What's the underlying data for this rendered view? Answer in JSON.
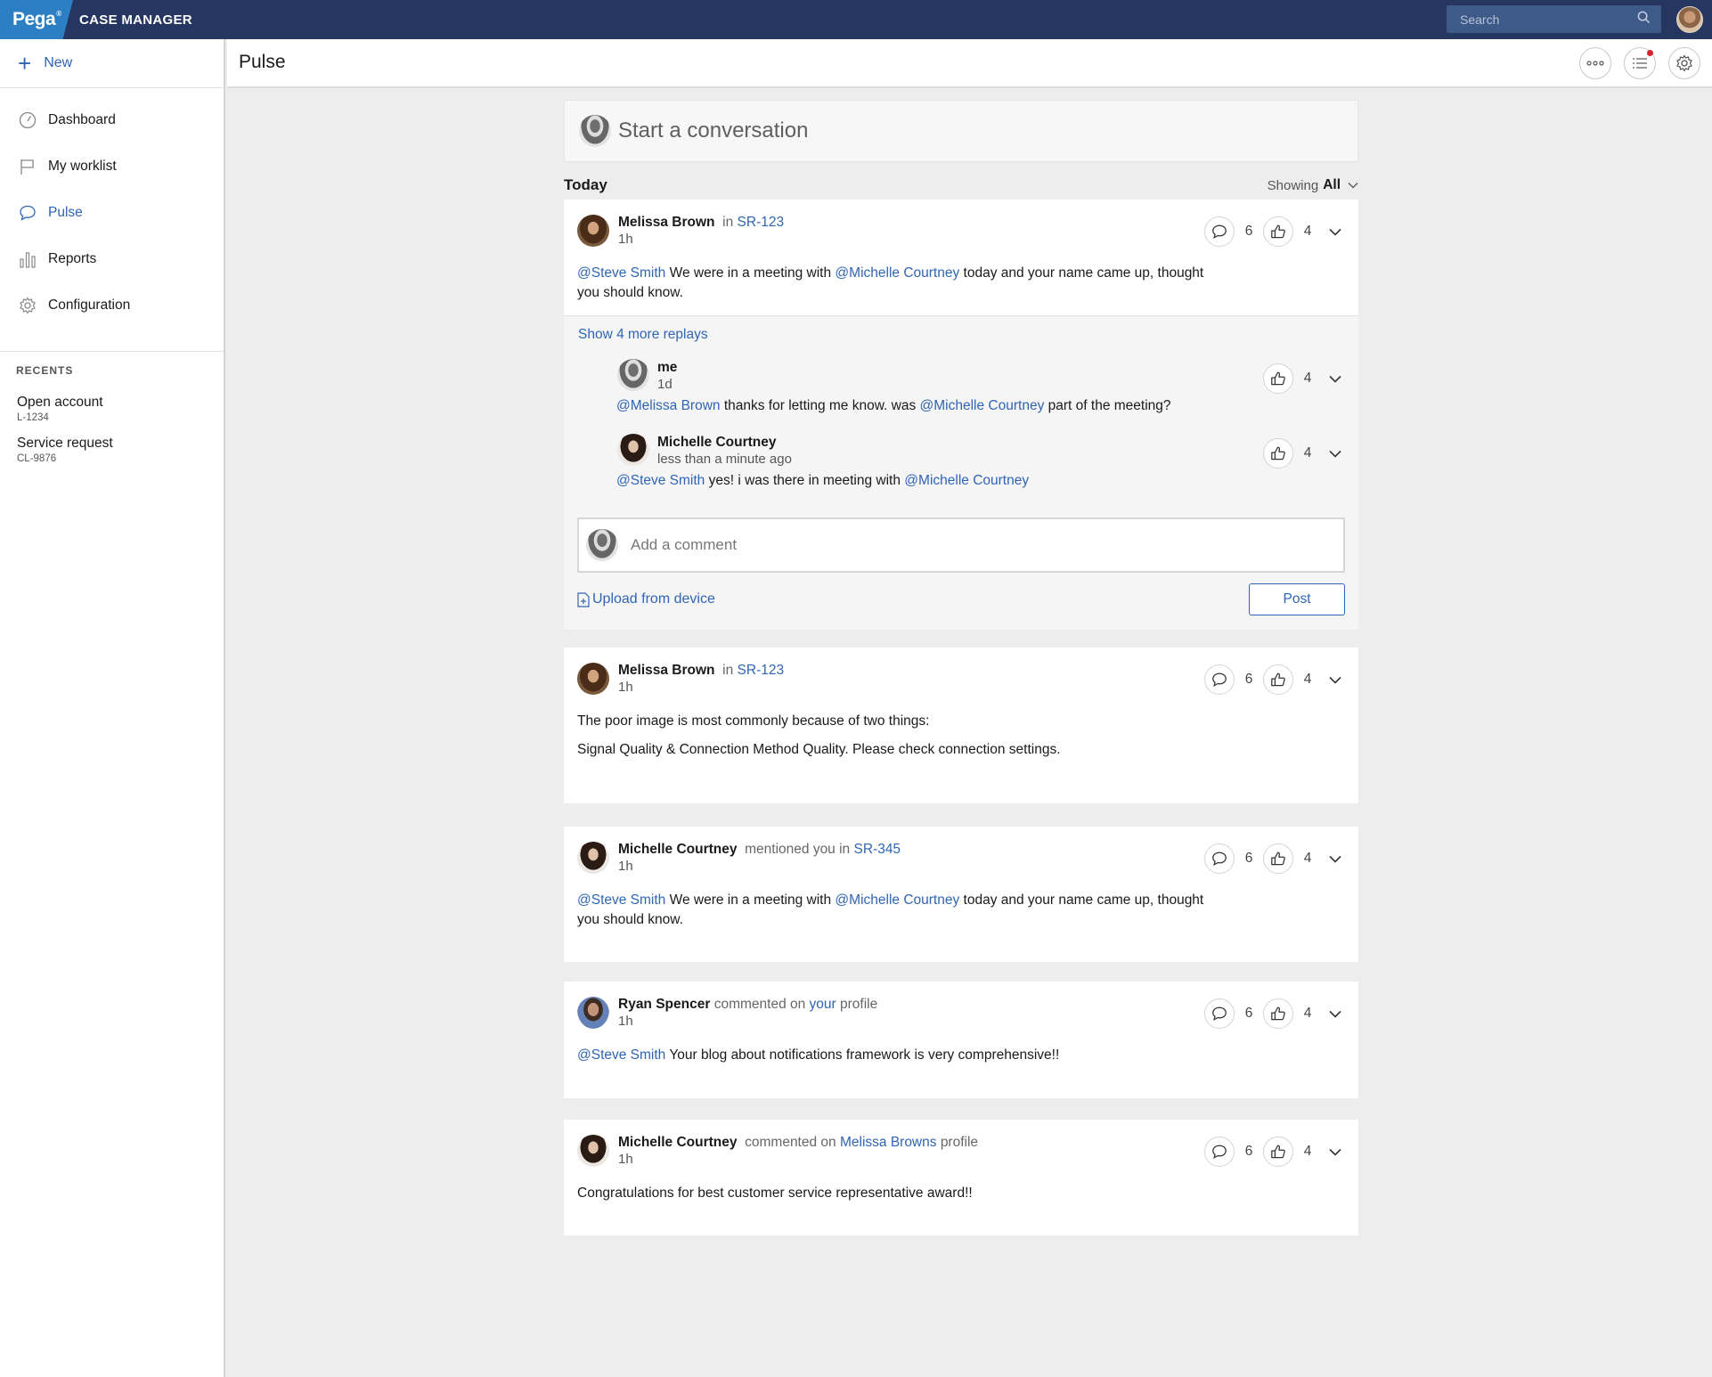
{
  "app": {
    "brand": "Pega",
    "brand_mark": "®",
    "name": "CASE MANAGER"
  },
  "search": {
    "placeholder": "Search"
  },
  "sidebar": {
    "new_label": "New",
    "items": [
      {
        "label": "Dashboard",
        "icon": "dashboard-icon"
      },
      {
        "label": "My worklist",
        "icon": "flag-icon"
      },
      {
        "label": "Pulse",
        "icon": "chat-icon",
        "active": true
      },
      {
        "label": "Reports",
        "icon": "bar-chart-icon"
      },
      {
        "label": "Configuration",
        "icon": "gear-icon"
      }
    ],
    "recents_heading": "RECENTS",
    "recents": [
      {
        "title": "Open account",
        "id": "L-1234"
      },
      {
        "title": "Service request",
        "id": "CL-9876"
      }
    ]
  },
  "header": {
    "title": "Pulse"
  },
  "colors": {
    "topbar": "#253661",
    "brand": "#2b7fc2",
    "link": "#2f65b4",
    "notification_dot": "#d0242a"
  },
  "feed": {
    "start_placeholder": "Start a conversation",
    "today_label": "Today",
    "showing_label": "Showing",
    "showing_value": "All",
    "posts": [
      {
        "author": "Melissa Brown",
        "context": "in",
        "link": "SR-123",
        "time": "1h",
        "comments": "6",
        "likes": "4",
        "mention1": "@Steve Smith",
        "text1": "We were in a meeting with",
        "mention2": "@Michelle Courtney",
        "text2": "today and your name came up, thought you should know.",
        "show_more": "Show 4 more replays",
        "replies": [
          {
            "author": "me",
            "time": "1d",
            "likes": "4",
            "mention1": "@Melissa Brown",
            "text1": "thanks for letting me know. was",
            "mention2": "@Michelle Courtney",
            "text2": "part of the meeting?"
          },
          {
            "author": "Michelle Courtney",
            "time": "less than a minute ago",
            "likes": "4",
            "mention1": "@Steve Smith",
            "text1": "yes! i was there in meeting with",
            "mention2": "@Michelle Courtney",
            "text2": ""
          }
        ],
        "comment_placeholder": "Add a comment",
        "upload_label": "Upload from device",
        "post_label": "Post"
      },
      {
        "author": "Melissa Brown",
        "context": "in",
        "link": "SR-123",
        "time": "1h",
        "comments": "6",
        "likes": "4",
        "line1": "The poor image is most commonly because of two things:",
        "line2": "Signal Quality & Connection Method Quality. Please check connection settings."
      },
      {
        "author": "Michelle Courtney",
        "context": "mentioned you in",
        "link": "SR-345",
        "time": "1h",
        "comments": "6",
        "likes": "4",
        "mention1": "@Steve Smith",
        "text1": "We were in a meeting with",
        "mention2": "@Michelle Courtney",
        "text2": "today and your name came up, thought you should know."
      },
      {
        "author": "Ryan Spencer",
        "context": "commented on",
        "link": "your",
        "suffix": "profile",
        "time": "1h",
        "comments": "6",
        "likes": "4",
        "mention1": "@Steve Smith",
        "text1": "Your blog about notifications framework is very comprehensive!!"
      },
      {
        "author": "Michelle Courtney",
        "context": "commented on",
        "link": "Melissa Browns",
        "suffix": "profile",
        "time": "1h",
        "comments": "6",
        "likes": "4",
        "text1": "Congratulations for best customer service representative award!!"
      }
    ]
  }
}
